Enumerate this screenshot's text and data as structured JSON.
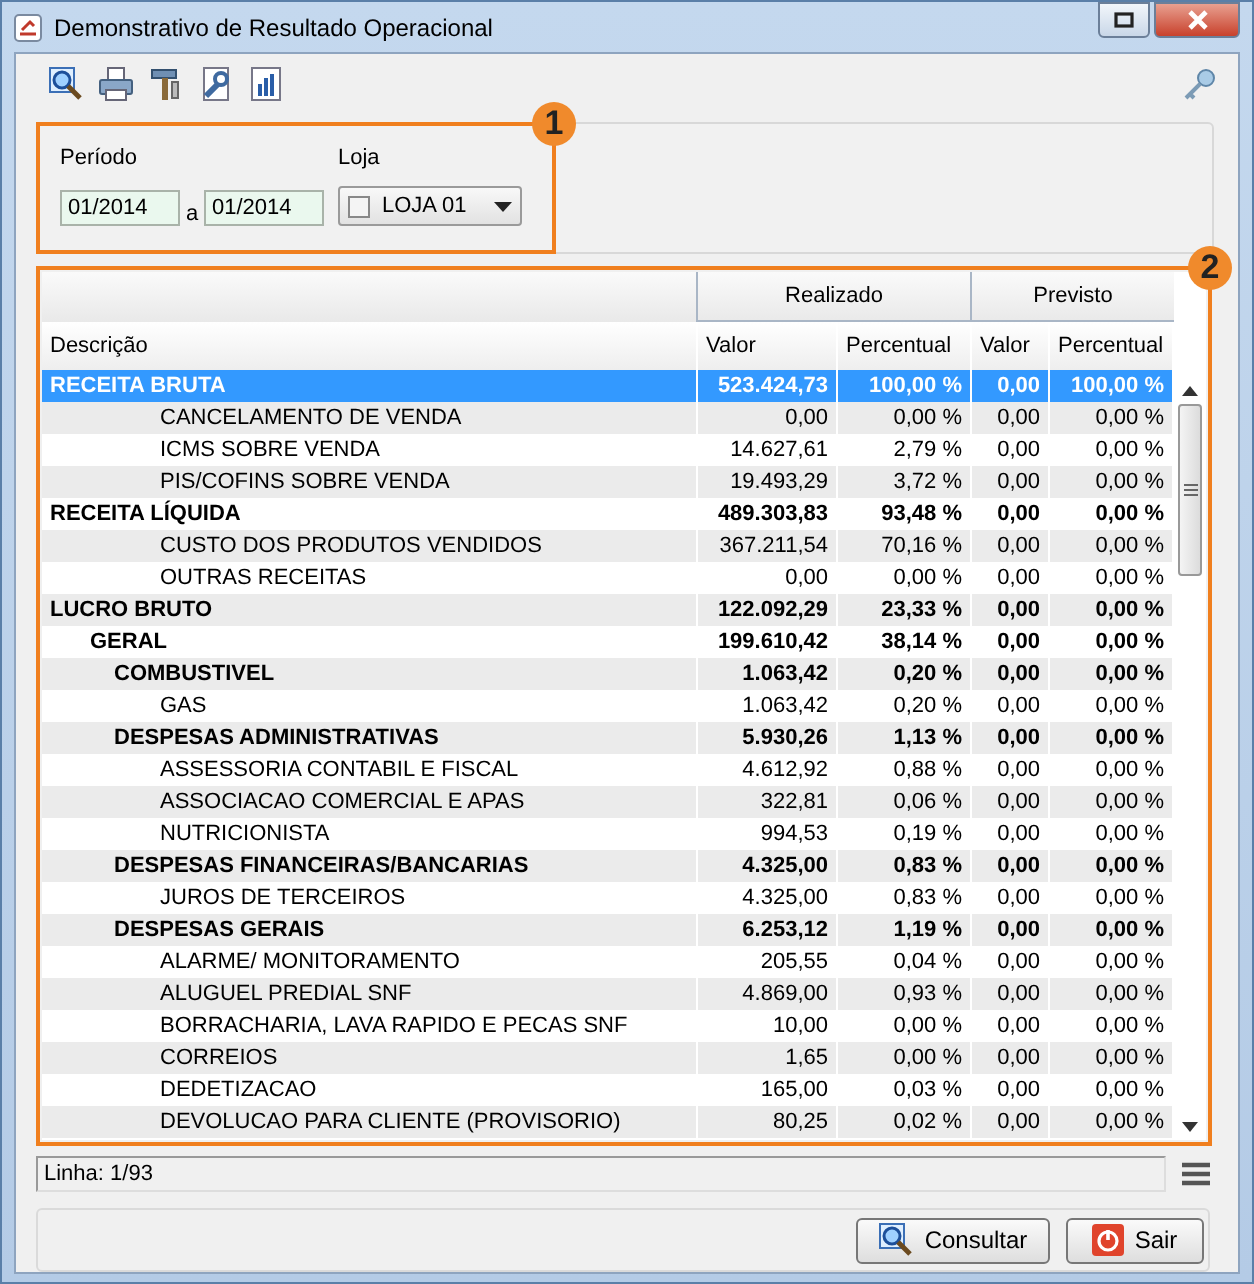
{
  "window": {
    "title": "Demonstrativo de Resultado Operacional"
  },
  "filters": {
    "period_label": "Período",
    "period_from": "01/2014",
    "separator": "a",
    "period_to": "01/2014",
    "store_label": "Loja",
    "store": {
      "value": "LOJA 01",
      "checked": false
    }
  },
  "callouts": [
    "1",
    "2"
  ],
  "table": {
    "group_headers": [
      "Realizado",
      "Previsto"
    ],
    "columns": [
      "Descrição",
      "Valor",
      "Percentual",
      "Valor",
      "Percentual"
    ],
    "rows": [
      {
        "kind": "group",
        "selected": true,
        "cells": [
          "RECEITA BRUTA",
          "523.424,73",
          "100,00 %",
          "0,00",
          "100,00 %"
        ],
        "children": [
          {
            "kind": "item",
            "selected": false,
            "cells": [
              "CANCELAMENTO DE VENDA",
              "0,00",
              "0,00 %",
              "0,00",
              "0,00 %"
            ]
          },
          {
            "kind": "item",
            "selected": false,
            "cells": [
              "ICMS SOBRE VENDA",
              "14.627,61",
              "2,79 %",
              "0,00",
              "0,00 %"
            ]
          },
          {
            "kind": "item",
            "selected": false,
            "cells": [
              "PIS/COFINS SOBRE VENDA",
              "19.493,29",
              "3,72 %",
              "0,00",
              "0,00 %"
            ]
          }
        ]
      },
      {
        "kind": "group",
        "selected": false,
        "cells": [
          "RECEITA LÍQUIDA",
          "489.303,83",
          "93,48 %",
          "0,00",
          "0,00 %"
        ],
        "children": [
          {
            "kind": "item",
            "selected": false,
            "cells": [
              "CUSTO DOS PRODUTOS VENDIDOS",
              "367.211,54",
              "70,16 %",
              "0,00",
              "0,00 %"
            ]
          },
          {
            "kind": "item",
            "selected": false,
            "cells": [
              "OUTRAS RECEITAS",
              "0,00",
              "0,00 %",
              "0,00",
              "0,00 %"
            ]
          }
        ]
      },
      {
        "kind": "group",
        "selected": false,
        "cells": [
          "LUCRO BRUTO",
          "122.092,29",
          "23,33 %",
          "0,00",
          "0,00 %"
        ],
        "children": [
          {
            "kind": "group",
            "selected": false,
            "cells": [
              "GERAL",
              "199.610,42",
              "38,14 %",
              "0,00",
              "0,00 %"
            ],
            "children": [
              {
                "kind": "group",
                "selected": false,
                "cells": [
                  "COMBUSTIVEL",
                  "1.063,42",
                  "0,20 %",
                  "0,00",
                  "0,00 %"
                ],
                "children": [
                  {
                    "kind": "item",
                    "selected": false,
                    "cells": [
                      "GAS",
                      "1.063,42",
                      "0,20 %",
                      "0,00",
                      "0,00 %"
                    ]
                  }
                ]
              },
              {
                "kind": "group",
                "selected": false,
                "cells": [
                  "DESPESAS ADMINISTRATIVAS",
                  "5.930,26",
                  "1,13 %",
                  "0,00",
                  "0,00 %"
                ],
                "children": [
                  {
                    "kind": "item",
                    "selected": false,
                    "cells": [
                      "ASSESSORIA CONTABIL E FISCAL",
                      "4.612,92",
                      "0,88 %",
                      "0,00",
                      "0,00 %"
                    ]
                  },
                  {
                    "kind": "item",
                    "selected": false,
                    "cells": [
                      "ASSOCIACAO COMERCIAL E APAS",
                      "322,81",
                      "0,06 %",
                      "0,00",
                      "0,00 %"
                    ]
                  },
                  {
                    "kind": "item",
                    "selected": false,
                    "cells": [
                      "NUTRICIONISTA",
                      "994,53",
                      "0,19 %",
                      "0,00",
                      "0,00 %"
                    ]
                  }
                ]
              },
              {
                "kind": "group",
                "selected": false,
                "cells": [
                  "DESPESAS FINANCEIRAS/BANCARIAS",
                  "4.325,00",
                  "0,83 %",
                  "0,00",
                  "0,00 %"
                ],
                "children": [
                  {
                    "kind": "item",
                    "selected": false,
                    "cells": [
                      "JUROS DE TERCEIROS",
                      "4.325,00",
                      "0,83 %",
                      "0,00",
                      "0,00 %"
                    ]
                  }
                ]
              },
              {
                "kind": "group",
                "selected": false,
                "cells": [
                  "DESPESAS GERAIS",
                  "6.253,12",
                  "1,19 %",
                  "0,00",
                  "0,00 %"
                ],
                "children": [
                  {
                    "kind": "item",
                    "selected": false,
                    "cells": [
                      "ALARME/ MONITORAMENTO",
                      "205,55",
                      "0,04 %",
                      "0,00",
                      "0,00 %"
                    ]
                  },
                  {
                    "kind": "item",
                    "selected": false,
                    "cells": [
                      "ALUGUEL PREDIAL SNF",
                      "4.869,00",
                      "0,93 %",
                      "0,00",
                      "0,00 %"
                    ]
                  },
                  {
                    "kind": "item",
                    "selected": false,
                    "cells": [
                      "BORRACHARIA, LAVA RAPIDO E PECAS SNF",
                      "10,00",
                      "0,00 %",
                      "0,00",
                      "0,00 %"
                    ]
                  },
                  {
                    "kind": "item",
                    "selected": false,
                    "cells": [
                      "CORREIOS",
                      "1,65",
                      "0,00 %",
                      "0,00",
                      "0,00 %"
                    ]
                  },
                  {
                    "kind": "item",
                    "selected": false,
                    "cells": [
                      "DEDETIZACAO",
                      "165,00",
                      "0,03 %",
                      "0,00",
                      "0,00 %"
                    ]
                  },
                  {
                    "kind": "item",
                    "selected": false,
                    "cells": [
                      "DEVOLUCAO PARA CLIENTE (PROVISORIO)",
                      "80,25",
                      "0,02 %",
                      "0,00",
                      "0,00 %"
                    ]
                  }
                ]
              }
            ]
          }
        ]
      }
    ]
  },
  "status": "Linha: 1/93",
  "buttons": [
    {
      "kind": "search",
      "label": "Consultar"
    },
    {
      "kind": "exit",
      "label": "Sair"
    }
  ]
}
